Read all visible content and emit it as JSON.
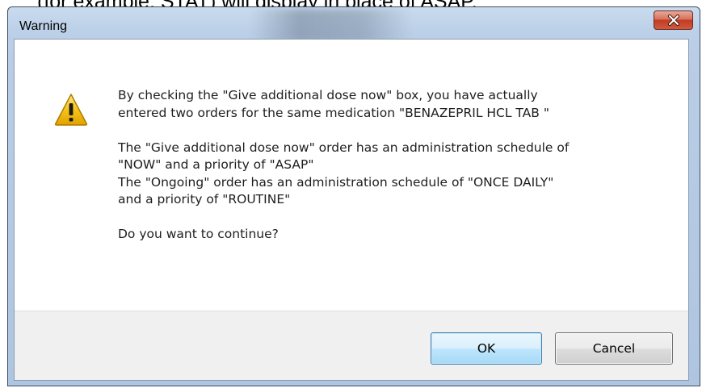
{
  "background_document": {
    "partial_text": "(for example, STAT) will display in place of ASAP."
  },
  "dialog": {
    "title": "Warning",
    "icon": "warning-icon",
    "close_glyph": "close-icon",
    "message_lines": [
      "By checking the \"Give additional dose now\" box, you have actually",
      "entered two orders for the same medication \"BENAZEPRIL HCL TAB \"",
      "The \"Give additional dose now\" order has an administration schedule of",
      "\"NOW\" and a priority of \"ASAP\"",
      "The \"Ongoing\" order has an administration schedule of \"ONCE DAILY\"",
      "and a priority of \"ROUTINE\"",
      "Do you want to continue?"
    ],
    "buttons": {
      "ok_label": "OK",
      "cancel_label": "Cancel"
    }
  },
  "colors": {
    "close_button": "#c23b22",
    "warning_triangle": "#f5c518",
    "ok_button_border": "#3c7fb1"
  }
}
